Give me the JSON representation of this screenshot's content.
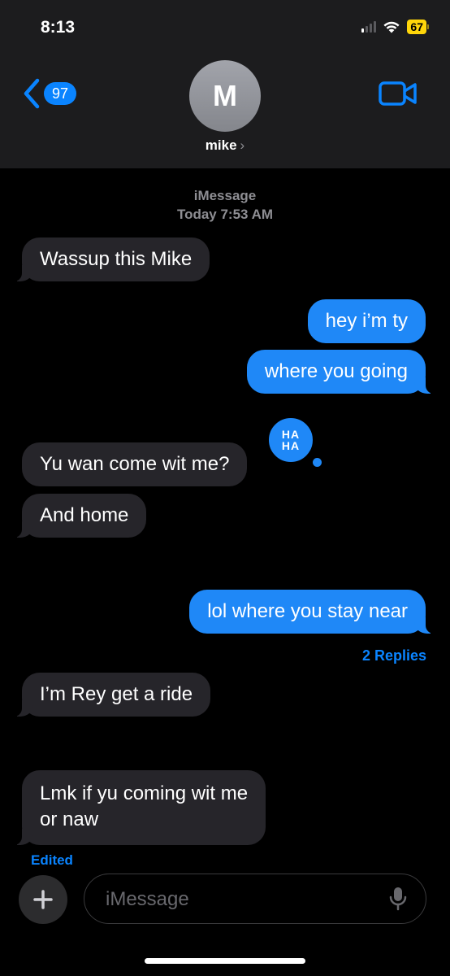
{
  "status_bar": {
    "time": "8:13",
    "battery": "67"
  },
  "header": {
    "back_count": "97",
    "avatar_initial": "M",
    "contact_name": "mike",
    "icons": {
      "back": "chevron-left-icon",
      "video": "video-camera-icon"
    }
  },
  "thread": {
    "service_label": "iMessage",
    "timestamp": "Today 7:53 AM",
    "messages": [
      {
        "direction": "incoming",
        "text": "Wassup this Mike"
      },
      {
        "direction": "outgoing",
        "text": "hey i’m ty"
      },
      {
        "direction": "outgoing",
        "text": "where you going"
      },
      {
        "direction": "incoming",
        "text": "Yu wan come wit me?",
        "tapback": "HA HA"
      },
      {
        "direction": "incoming",
        "text": "And home"
      },
      {
        "direction": "outgoing",
        "text": "lol where you stay near",
        "replies_label": "2 Replies"
      },
      {
        "direction": "incoming",
        "text": "I’m Rey get a ride"
      },
      {
        "direction": "incoming",
        "text_line1": "Lmk if yu coming wit me",
        "text_line2": "or naw",
        "edited_label": "Edited"
      }
    ],
    "tapback_line1": "HA",
    "tapback_line2": "HA"
  },
  "compose": {
    "placeholder": "iMessage",
    "icons": {
      "plus": "plus-icon",
      "mic": "microphone-icon"
    }
  },
  "colors": {
    "outgoing": "#1f88f7",
    "incoming": "#26252a",
    "accent": "#0a84ff",
    "header_bg": "#1c1c1e"
  }
}
